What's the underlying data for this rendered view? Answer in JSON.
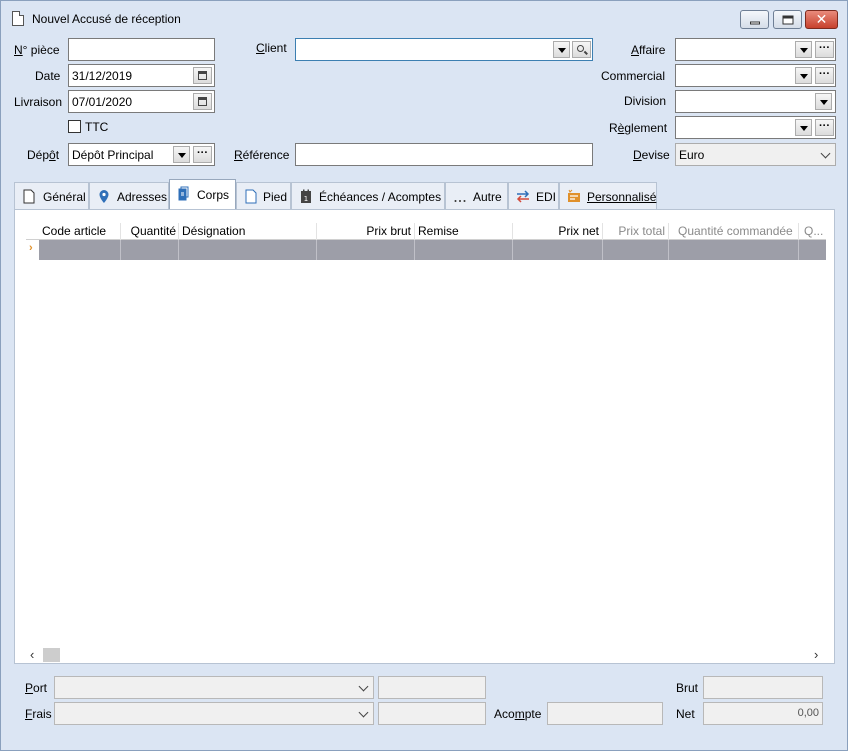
{
  "window": {
    "title": "Nouvel Accusé de réception",
    "controls": {
      "minimize": "minimize",
      "maximize": "maximize",
      "close": "✕"
    }
  },
  "header": {
    "numero_piece": {
      "label_ul": "N",
      "label_rest": "° pièce",
      "value": ""
    },
    "date": {
      "label": "Date",
      "value": "31/12/2019"
    },
    "livraison": {
      "label": "Livraison",
      "value": "07/01/2020"
    },
    "ttc": {
      "label": "TTC",
      "checked": false
    },
    "depot": {
      "label_pre": "Dép",
      "label_ul": "ô",
      "label_post": "t",
      "value": "Dépôt Principal"
    },
    "client": {
      "label_ul": "C",
      "label_rest": "lient",
      "value": ""
    },
    "reference": {
      "label_ul": "R",
      "label_rest": "éférence",
      "value": ""
    },
    "affaire": {
      "label_ul": "A",
      "label_rest": "ffaire",
      "value": ""
    },
    "commercial": {
      "label": "Commercial",
      "value": ""
    },
    "division": {
      "label": "Division",
      "value": ""
    },
    "reglement": {
      "label_pre": "R",
      "label_ul": "è",
      "label_post": "glement",
      "value": ""
    },
    "devise": {
      "label_ul": "D",
      "label_rest": "evise",
      "value": "Euro"
    }
  },
  "tabs": [
    {
      "label": "Général",
      "icon": "document-icon"
    },
    {
      "label": "Adresses",
      "icon": "map-pin-icon"
    },
    {
      "label": "Corps",
      "icon": "document-stack-icon",
      "active": true
    },
    {
      "label": "Pied",
      "icon": "document-icon"
    },
    {
      "label": "Échéances / Acomptes",
      "icon": "calendar-icon"
    },
    {
      "label": "Autre",
      "icon": "ellipsis-icon"
    },
    {
      "label": "EDI",
      "icon": "exchange-arrows-icon"
    },
    {
      "label": "Personnalisé",
      "icon": "custom-fields-icon"
    }
  ],
  "grid": {
    "columns": [
      {
        "label": "Code article",
        "enabled": true
      },
      {
        "label": "Quantité",
        "enabled": true
      },
      {
        "label": "Désignation",
        "enabled": true
      },
      {
        "label": "Prix brut",
        "enabled": true
      },
      {
        "label": "Remise",
        "enabled": true
      },
      {
        "label": "Prix net",
        "enabled": true
      },
      {
        "label": "Prix total",
        "enabled": false
      },
      {
        "label": "Quantité commandée",
        "enabled": false
      },
      {
        "label": "Q...",
        "enabled": false
      }
    ],
    "row_marker": "›",
    "scroll_left": "‹",
    "scroll_right": "›"
  },
  "footer": {
    "port": {
      "label_ul": "P",
      "label_rest": "ort",
      "value": "",
      "amount": ""
    },
    "frais": {
      "label_ul": "F",
      "label_rest": "rais",
      "value": "",
      "amount": ""
    },
    "acompte": {
      "label_pre": "Aco",
      "label_ul": "m",
      "label_post": "pte",
      "value": ""
    },
    "brut": {
      "label": "Brut",
      "value": ""
    },
    "net": {
      "label": "Net",
      "value": "0,00"
    }
  },
  "colors": {
    "window_bg": "#dbe5f3",
    "grid_selection": "#9d9ea8",
    "close_button": "#c7412d",
    "row_marker": "#e0902a"
  }
}
